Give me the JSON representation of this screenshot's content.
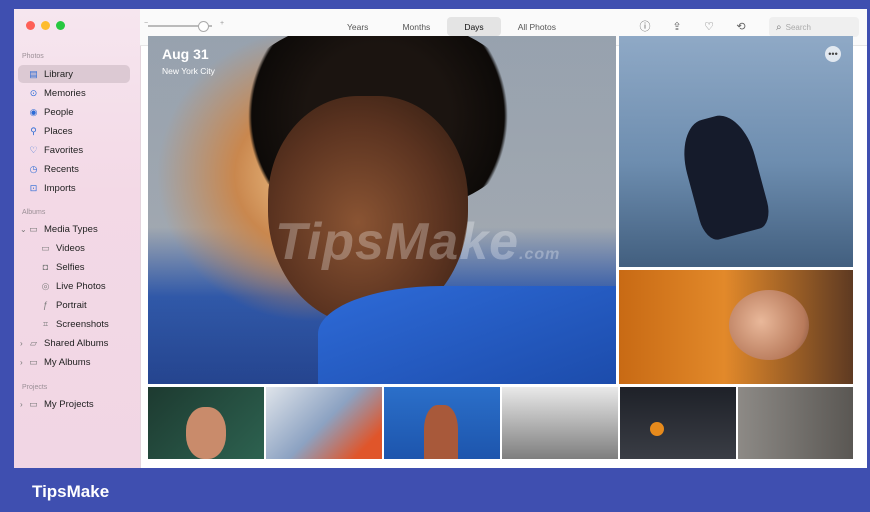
{
  "window": {
    "traffic_lights": [
      "#fe5f57",
      "#febc2e",
      "#28c840"
    ]
  },
  "sidebar": {
    "photos_heading": "Photos",
    "photos_items": [
      {
        "label": "Library",
        "icon": "library-icon",
        "active": true
      },
      {
        "label": "Memories",
        "icon": "memories-icon"
      },
      {
        "label": "People",
        "icon": "people-icon"
      },
      {
        "label": "Places",
        "icon": "places-icon"
      },
      {
        "label": "Favorites",
        "icon": "heart-icon"
      },
      {
        "label": "Recents",
        "icon": "clock-icon"
      },
      {
        "label": "Imports",
        "icon": "import-icon"
      }
    ],
    "albums_heading": "Albums",
    "albums_items": [
      {
        "label": "Media Types",
        "icon": "folder-icon"
      },
      {
        "label": "Videos",
        "icon": "video-icon"
      },
      {
        "label": "Selfies",
        "icon": "selfie-icon"
      },
      {
        "label": "Live Photos",
        "icon": "live-photo-icon"
      },
      {
        "label": "Portrait",
        "icon": "portrait-icon"
      },
      {
        "label": "Screenshots",
        "icon": "screenshot-icon"
      },
      {
        "label": "Shared Albums",
        "icon": "shared-album-icon"
      },
      {
        "label": "My Albums",
        "icon": "folder-icon"
      }
    ],
    "projects_heading": "Projects",
    "projects_items": [
      {
        "label": "My Projects",
        "icon": "folder-icon"
      }
    ]
  },
  "toolbar": {
    "tabs": [
      "Years",
      "Months",
      "Days",
      "All Photos"
    ],
    "active_tab": "Days",
    "zoom_level": 0.8,
    "search_placeholder": "Search",
    "icons": [
      "info-icon",
      "share-icon",
      "heart-icon",
      "rotate-icon"
    ]
  },
  "hero": {
    "date": "Aug 31",
    "location": "New York City"
  },
  "watermark": "TipsMake",
  "watermark_suffix": ".com",
  "brand": "TipsMake"
}
